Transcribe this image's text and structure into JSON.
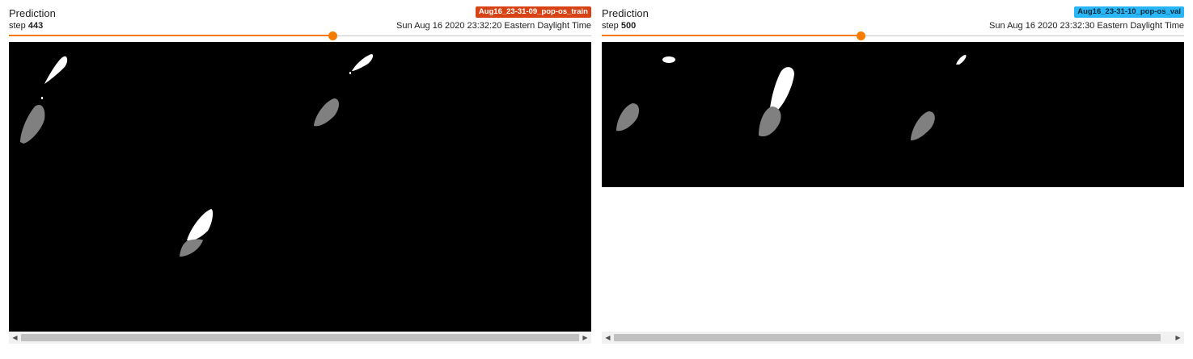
{
  "cards": [
    {
      "title": "Prediction",
      "run": "Aug16_23-31-09_pop-os_train",
      "run_color": "#d84315",
      "step_label": "step",
      "step_value": "443",
      "timestamp": "Sun Aug 16 2020 23:32:20 Eastern Daylight Time",
      "slider_fraction": 0.555,
      "accent_color": "#f57c00"
    },
    {
      "title": "Prediction",
      "run": "Aug16_23-31-10_pop-os_val",
      "run_color": "#29b6f6",
      "step_label": "step",
      "step_value": "500",
      "timestamp": "Sun Aug 16 2020 23:32:30 Eastern Daylight Time",
      "slider_fraction": 0.444,
      "accent_color": "#f57c00"
    }
  ],
  "scrollbar": {
    "left_arrow_icon": "triangle-left-icon",
    "right_arrow_icon": "triangle-right-icon"
  }
}
